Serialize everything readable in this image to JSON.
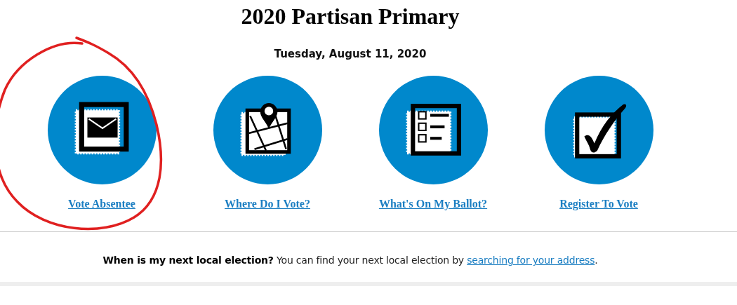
{
  "title": "2020 Partisan Primary",
  "date": "Tuesday, August 11, 2020",
  "actions": [
    {
      "kind": "envelope",
      "label": "Vote Absentee",
      "circled": true
    },
    {
      "kind": "map",
      "label": "Where Do I Vote?",
      "circled": false
    },
    {
      "kind": "ballot",
      "label": "What's On My Ballot?",
      "circled": false
    },
    {
      "kind": "check",
      "label": "Register To Vote",
      "circled": false
    }
  ],
  "note": {
    "text": "**When is my next local election?** You can find your next local election by ",
    "link": "searching for your address",
    "end": "."
  }
}
